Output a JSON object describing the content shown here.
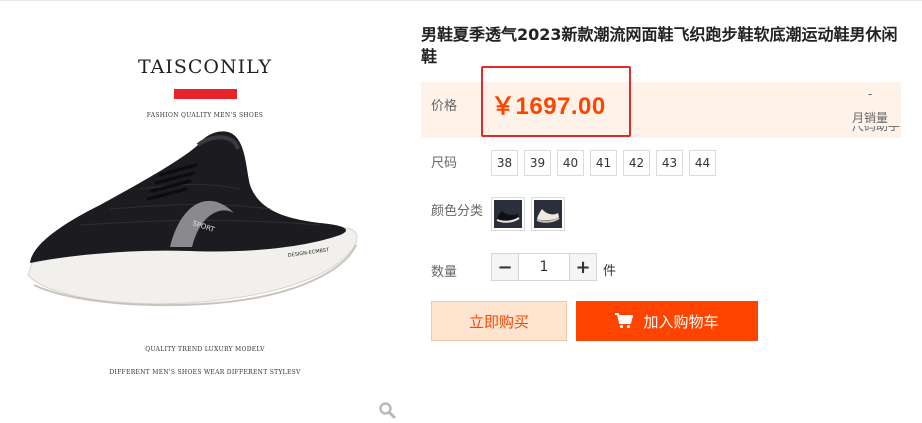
{
  "gallery": {
    "brand": "TAISCONILY",
    "tagline_top": "FASHION QUALITY MEN'S SHOES",
    "tagline_bottom_1": "QUALITY TREND LUXURY MODELV",
    "tagline_bottom_2": "DIFFERENT MEN'S SHOES WEAR DIFFERENT STYLESV",
    "shoe_print_side": "SPORT",
    "shoe_print_heel": "DESIGN-ECMBST",
    "zoom_icon": "magnifier-icon"
  },
  "product": {
    "title": "男鞋夏季透气2023新款潮流网面鞋飞织跑步鞋软底潮运动鞋男休闲鞋"
  },
  "price": {
    "label": "价格",
    "value": "￥1697.00",
    "highlight_color": "#e12b2b",
    "accent_color": "#ff4400"
  },
  "sales": {
    "count": "-",
    "label": "月销量",
    "size_chart_partial": "尺码助手"
  },
  "size": {
    "label": "尺码",
    "options": [
      "38",
      "39",
      "40",
      "41",
      "42",
      "43",
      "44"
    ]
  },
  "color": {
    "label": "颜色分类",
    "options": [
      {
        "name": "black-shoe-thumbnail"
      },
      {
        "name": "white-shoe-thumbnail"
      }
    ]
  },
  "quantity": {
    "label": "数量",
    "value": "1",
    "minus": "−",
    "plus": "+",
    "unit": "件"
  },
  "actions": {
    "buy_now": "立即购买",
    "add_to_cart": "加入购物车",
    "cart_icon": "cart-icon"
  }
}
